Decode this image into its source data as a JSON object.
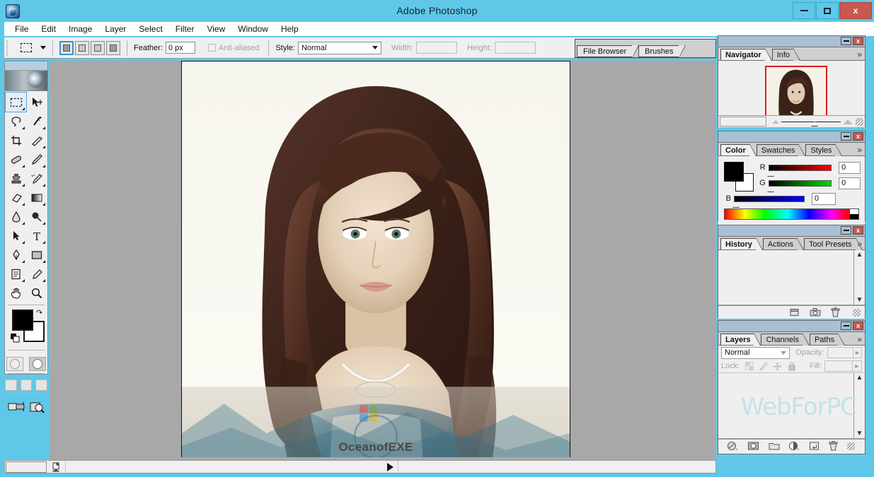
{
  "window": {
    "title": "Adobe Photoshop",
    "app_icon": "photoshop-icon",
    "minimize_label": "",
    "maximize_label": "",
    "close_label": "x"
  },
  "menubar": {
    "items": [
      "File",
      "Edit",
      "Image",
      "Layer",
      "Select",
      "Filter",
      "View",
      "Window",
      "Help"
    ]
  },
  "options_bar": {
    "tool_icon": "rectangular-marquee-icon",
    "selection_modes": [
      "new-selection",
      "add-to-selection",
      "subtract-from-selection",
      "intersect-with-selection"
    ],
    "feather_label": "Feather:",
    "feather_value": "0 px",
    "antialiased_label": "Anti-aliased",
    "style_label": "Style:",
    "style_value": "Normal",
    "width_label": "Width:",
    "width_value": "",
    "height_label": "Height:",
    "height_value": ""
  },
  "palette_well": {
    "tabs": [
      "File Browser",
      "Brushes"
    ]
  },
  "toolbox": {
    "tools": [
      {
        "name": "rectangular-marquee-tool",
        "selected": true
      },
      {
        "name": "move-tool",
        "selected": false
      },
      {
        "name": "lasso-tool",
        "selected": false
      },
      {
        "name": "magic-wand-tool",
        "selected": false
      },
      {
        "name": "crop-tool",
        "selected": false
      },
      {
        "name": "slice-tool",
        "selected": false
      },
      {
        "name": "healing-brush-tool",
        "selected": false
      },
      {
        "name": "brush-tool",
        "selected": false
      },
      {
        "name": "clone-stamp-tool",
        "selected": false
      },
      {
        "name": "history-brush-tool",
        "selected": false
      },
      {
        "name": "eraser-tool",
        "selected": false
      },
      {
        "name": "gradient-tool",
        "selected": false
      },
      {
        "name": "blur-tool",
        "selected": false
      },
      {
        "name": "dodge-tool",
        "selected": false
      },
      {
        "name": "path-selection-tool",
        "selected": false
      },
      {
        "name": "type-tool",
        "selected": false
      },
      {
        "name": "pen-tool",
        "selected": false
      },
      {
        "name": "rectangle-shape-tool",
        "selected": false
      },
      {
        "name": "notes-tool",
        "selected": false
      },
      {
        "name": "eyedropper-tool",
        "selected": false
      },
      {
        "name": "hand-tool",
        "selected": false
      },
      {
        "name": "zoom-tool",
        "selected": false
      }
    ],
    "foreground_color": "#000000",
    "background_color": "#ffffff",
    "quick_mask_modes": [
      "standard-mode",
      "quick-mask-mode"
    ],
    "screen_modes": [
      "standard-screen-mode",
      "full-screen-with-menubar",
      "full-screen-mode"
    ],
    "jump_to": [
      "jump-to-imageready-icon",
      "jump-to-other-icon"
    ]
  },
  "navigator_panel": {
    "tabs": [
      "Navigator",
      "Info"
    ],
    "active_tab": "Navigator",
    "zoom_value": "",
    "more_label": "»"
  },
  "color_panel": {
    "tabs": [
      "Color",
      "Swatches",
      "Styles"
    ],
    "active_tab": "Color",
    "channels": [
      {
        "label": "R",
        "value": "0"
      },
      {
        "label": "G",
        "value": "0"
      },
      {
        "label": "B",
        "value": "0"
      }
    ],
    "more_label": "»"
  },
  "history_panel": {
    "tabs": [
      "History",
      "Actions",
      "Tool Presets"
    ],
    "active_tab": "History",
    "items": [],
    "footer_icons": [
      "create-new-document-icon",
      "create-new-snapshot-icon",
      "delete-state-icon"
    ],
    "more_label": "»"
  },
  "layers_panel": {
    "tabs": [
      "Layers",
      "Channels",
      "Paths"
    ],
    "active_tab": "Layers",
    "blend_mode": "Normal",
    "opacity_label": "Opacity:",
    "opacity_value": "",
    "lock_label": "Lock:",
    "lock_icons": [
      "lock-transparent-pixels-icon",
      "lock-image-pixels-icon",
      "lock-position-icon",
      "lock-all-icon"
    ],
    "fill_label": "Fill:",
    "fill_value": "",
    "layers": [],
    "footer_icons": [
      "layer-style-icon",
      "layer-mask-icon",
      "new-group-icon",
      "adjustment-layer-icon",
      "new-layer-icon",
      "delete-layer-icon"
    ],
    "more_label": "»"
  },
  "status_bar": {
    "zoom_value": "",
    "doc_icon": "document-icon",
    "info_text": "",
    "play_icon": "menu-arrow-icon"
  },
  "canvas": {
    "watermark": "OceanofEXE"
  },
  "watermark": {
    "text": "WebForPC"
  },
  "colors": {
    "titlebar": "#5fc8e8",
    "close_button": "#c9584e",
    "panel_title": "#a9bfd4",
    "panel_body": "#efefef",
    "navigator_view_box": "#e01c1c",
    "canvas_backdrop": "#a8a8a8"
  }
}
